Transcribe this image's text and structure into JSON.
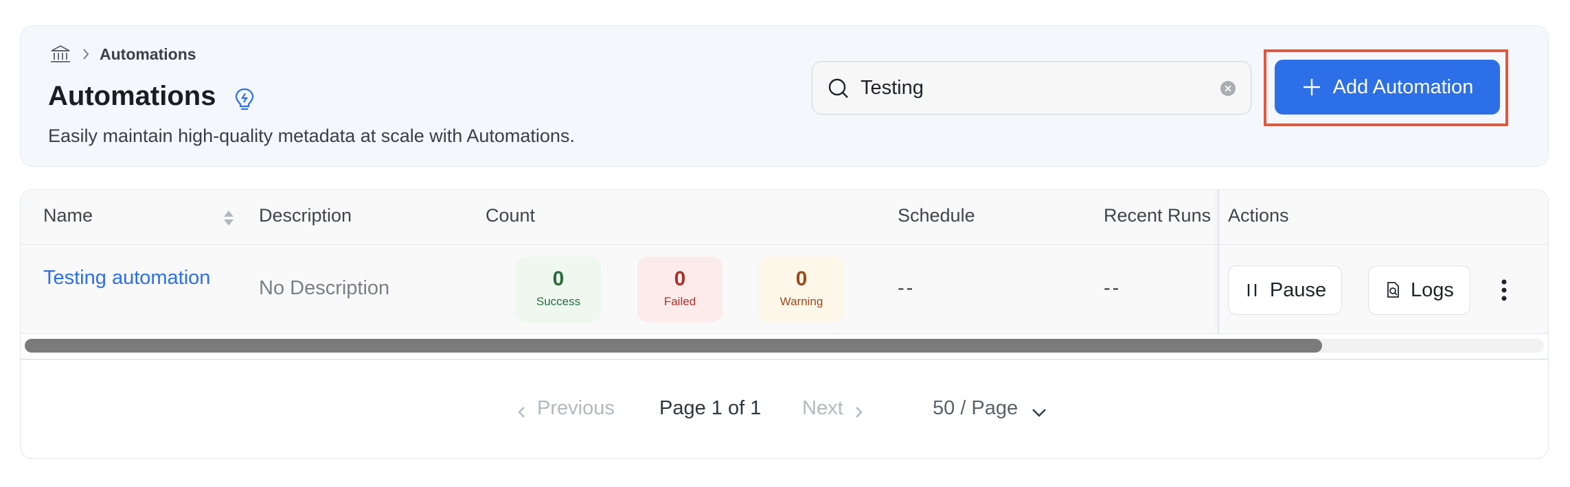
{
  "breadcrumb": {
    "home_icon": "bank-icon",
    "current": "Automations"
  },
  "header": {
    "title": "Automations",
    "subtitle": "Easily maintain high-quality metadata at scale with Automations."
  },
  "search": {
    "value": "Testing",
    "placeholder": ""
  },
  "add_button": {
    "label": "Add Automation"
  },
  "table": {
    "columns": [
      "Name",
      "Description",
      "Count",
      "Schedule",
      "Recent Runs",
      "Actions"
    ],
    "rows": [
      {
        "name": "Testing automation",
        "description": "No Description",
        "counts": [
          {
            "value": "0",
            "label": "Success"
          },
          {
            "value": "0",
            "label": "Failed"
          },
          {
            "value": "0",
            "label": "Warning"
          }
        ],
        "schedule": "--",
        "recent_runs": "--",
        "actions": {
          "pause": "Pause",
          "logs": "Logs"
        }
      }
    ]
  },
  "pagination": {
    "previous": "Previous",
    "page_info": "Page 1 of 1",
    "next": "Next",
    "page_size": "50 / Page"
  },
  "colors": {
    "accent": "#2d6fe6",
    "highlight_border": "#e8553a",
    "success": "#2d6b3c",
    "failed": "#a8322a",
    "warning": "#9a4a1d"
  }
}
